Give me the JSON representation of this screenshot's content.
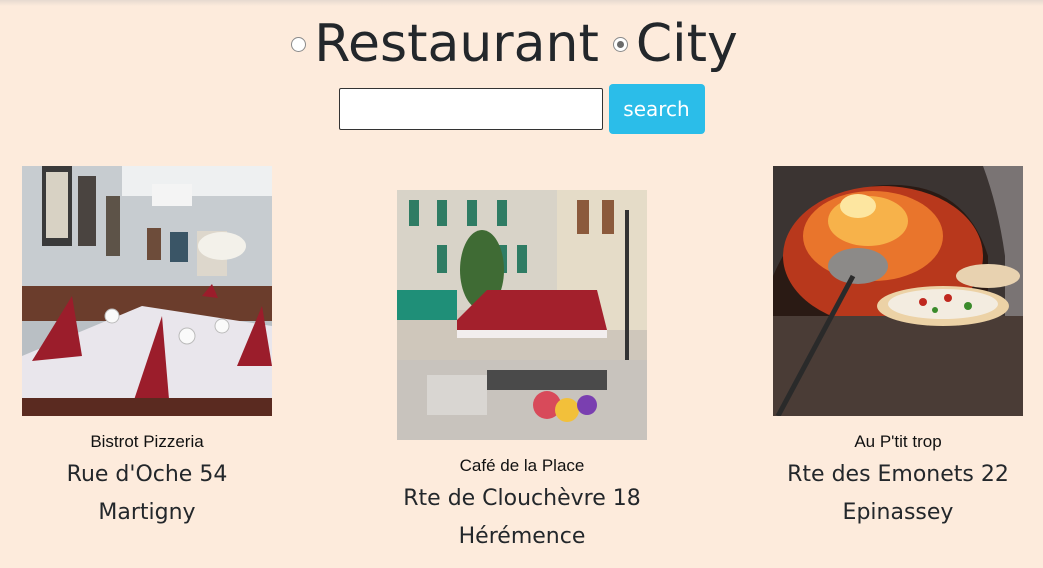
{
  "search_type": {
    "options": [
      {
        "label": "Restaurant",
        "checked": false
      },
      {
        "label": "City",
        "checked": true
      }
    ]
  },
  "search": {
    "value": "",
    "button_label": "search"
  },
  "colors": {
    "background": "#fdebdc",
    "button": "#2bbde9"
  },
  "restaurants": [
    {
      "name": "Bistrot Pizzeria",
      "address": "Rue d'Oche 54",
      "city": "Martigny"
    },
    {
      "name": "Café de la Place",
      "address": "Rte de Clouchèvre 18",
      "city": "Hérémence"
    },
    {
      "name": "Au P'tit trop",
      "address": "Rte des Emonets 22",
      "city": "Epinassey"
    }
  ]
}
